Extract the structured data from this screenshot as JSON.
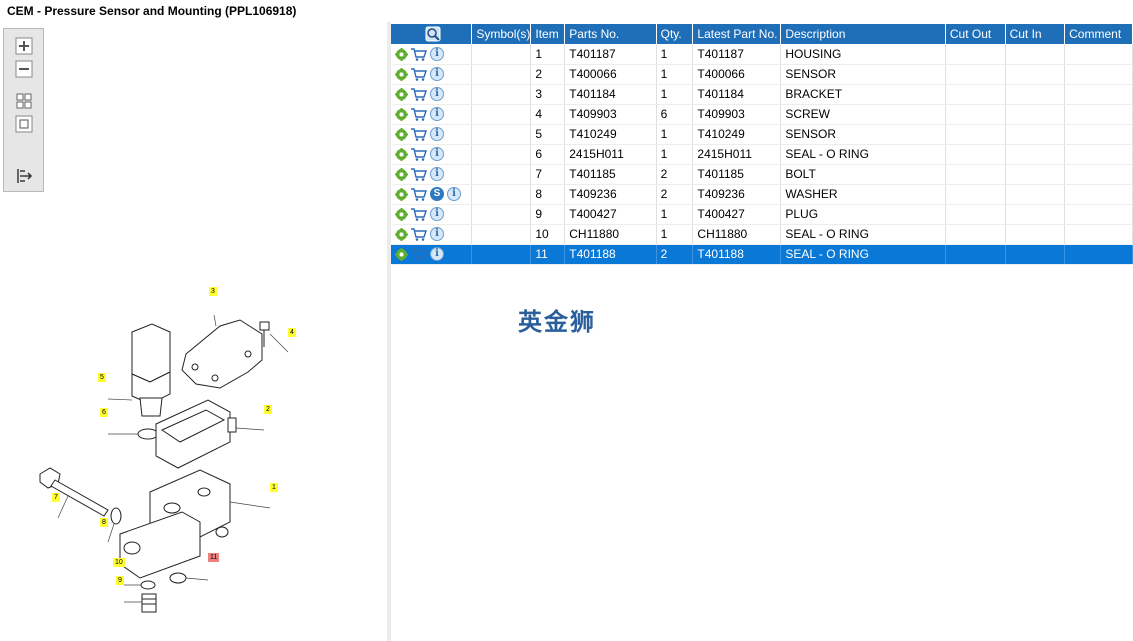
{
  "title": "CEM - Pressure Sensor and Mounting (PPL106918)",
  "watermark": "英金狮",
  "colors": {
    "header_bg": "#1f6fb8",
    "selected_row_bg": "#0a78d7",
    "callout": "#ffff33"
  },
  "toolbar": {
    "icons": [
      "zoom-in-icon",
      "zoom-out-icon",
      "fit-view-icon",
      "actual-size-icon",
      "export-icon"
    ]
  },
  "table": {
    "columns": [
      "Symbol(s)",
      "Item",
      "Parts No.",
      "Qty.",
      "Latest Part No.",
      "Description",
      "Cut Out",
      "Cut In",
      "Comment"
    ],
    "rows": [
      {
        "item": "1",
        "part": "T401187",
        "qty": "1",
        "latest": "T401187",
        "desc": "HOUSING",
        "s": ""
      },
      {
        "item": "2",
        "part": "T400066",
        "qty": "1",
        "latest": "T400066",
        "desc": "SENSOR",
        "s": ""
      },
      {
        "item": "3",
        "part": "T401184",
        "qty": "1",
        "latest": "T401184",
        "desc": "BRACKET",
        "s": ""
      },
      {
        "item": "4",
        "part": "T409903",
        "qty": "6",
        "latest": "T409903",
        "desc": "SCREW",
        "s": ""
      },
      {
        "item": "5",
        "part": "T410249",
        "qty": "1",
        "latest": "T410249",
        "desc": "SENSOR",
        "s": ""
      },
      {
        "item": "6",
        "part": "2415H011",
        "qty": "1",
        "latest": "2415H011",
        "desc": "SEAL - O RING",
        "s": ""
      },
      {
        "item": "7",
        "part": "T401185",
        "qty": "2",
        "latest": "T401185",
        "desc": "BOLT",
        "s": ""
      },
      {
        "item": "8",
        "part": "T409236",
        "qty": "2",
        "latest": "T409236",
        "desc": "WASHER",
        "s": "S"
      },
      {
        "item": "9",
        "part": "T400427",
        "qty": "1",
        "latest": "T400427",
        "desc": "PLUG",
        "s": ""
      },
      {
        "item": "10",
        "part": "CH11880",
        "qty": "1",
        "latest": "CH11880",
        "desc": "SEAL - O RING",
        "s": ""
      },
      {
        "item": "11",
        "part": "T401188",
        "qty": "2",
        "latest": "T401188",
        "desc": "SEAL - O RING",
        "s": ""
      }
    ],
    "selected_item": "11"
  },
  "diagram": {
    "callouts": [
      "1",
      "2",
      "3",
      "4",
      "5",
      "6",
      "7",
      "8",
      "9",
      "10",
      "11"
    ]
  }
}
